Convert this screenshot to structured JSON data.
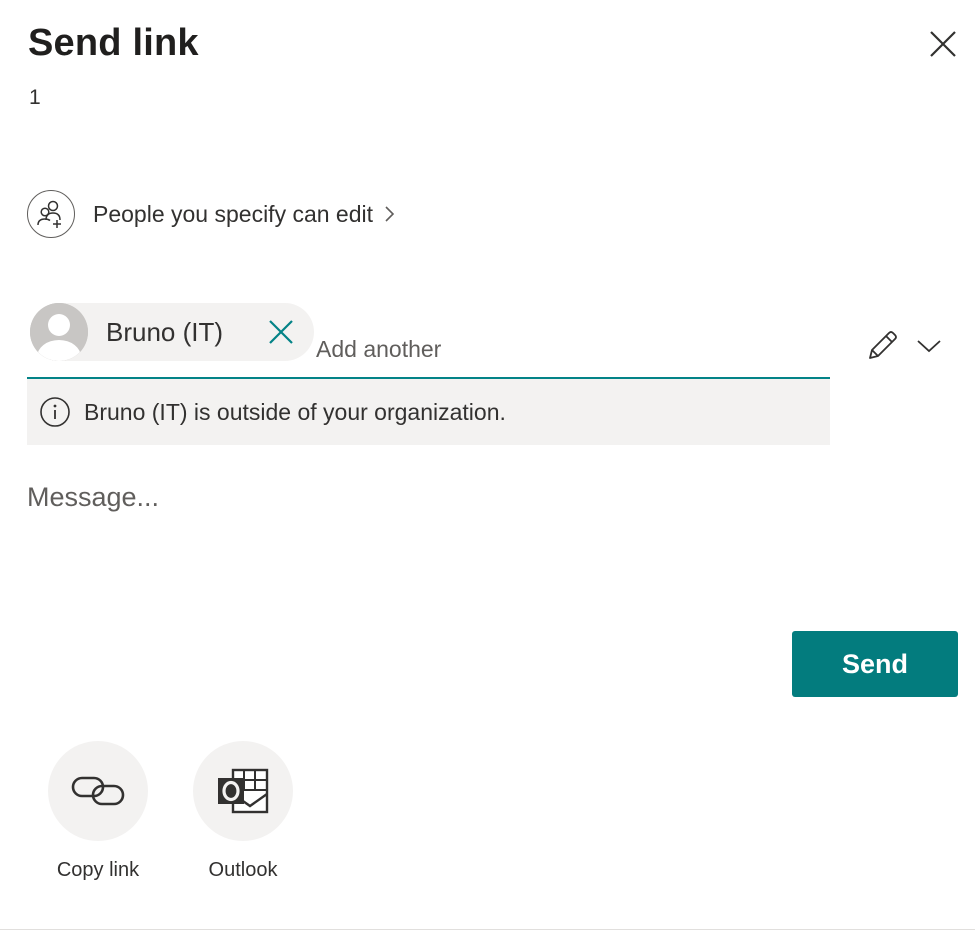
{
  "dialog": {
    "title": "Send link",
    "item_count": "1"
  },
  "permission": {
    "label": "People you specify can edit",
    "icon": "people-add-icon"
  },
  "recipients": {
    "chips": [
      {
        "name": "Bruno (IT)"
      }
    ],
    "add_placeholder": "Add another"
  },
  "edit_permission": {
    "icon": "pencil-icon",
    "dropdown_icon": "chevron-down-icon"
  },
  "notice": {
    "text": "Bruno (IT) is outside of your organization.",
    "icon": "info-icon"
  },
  "message": {
    "placeholder": "Message..."
  },
  "actions": {
    "send_label": "Send"
  },
  "share_options": [
    {
      "label": "Copy link",
      "icon": "link-icon"
    },
    {
      "label": "Outlook",
      "icon": "outlook-icon"
    }
  ],
  "colors": {
    "accent": "#037c7e",
    "chip_background": "#f3f2f1",
    "text": "#323130"
  }
}
